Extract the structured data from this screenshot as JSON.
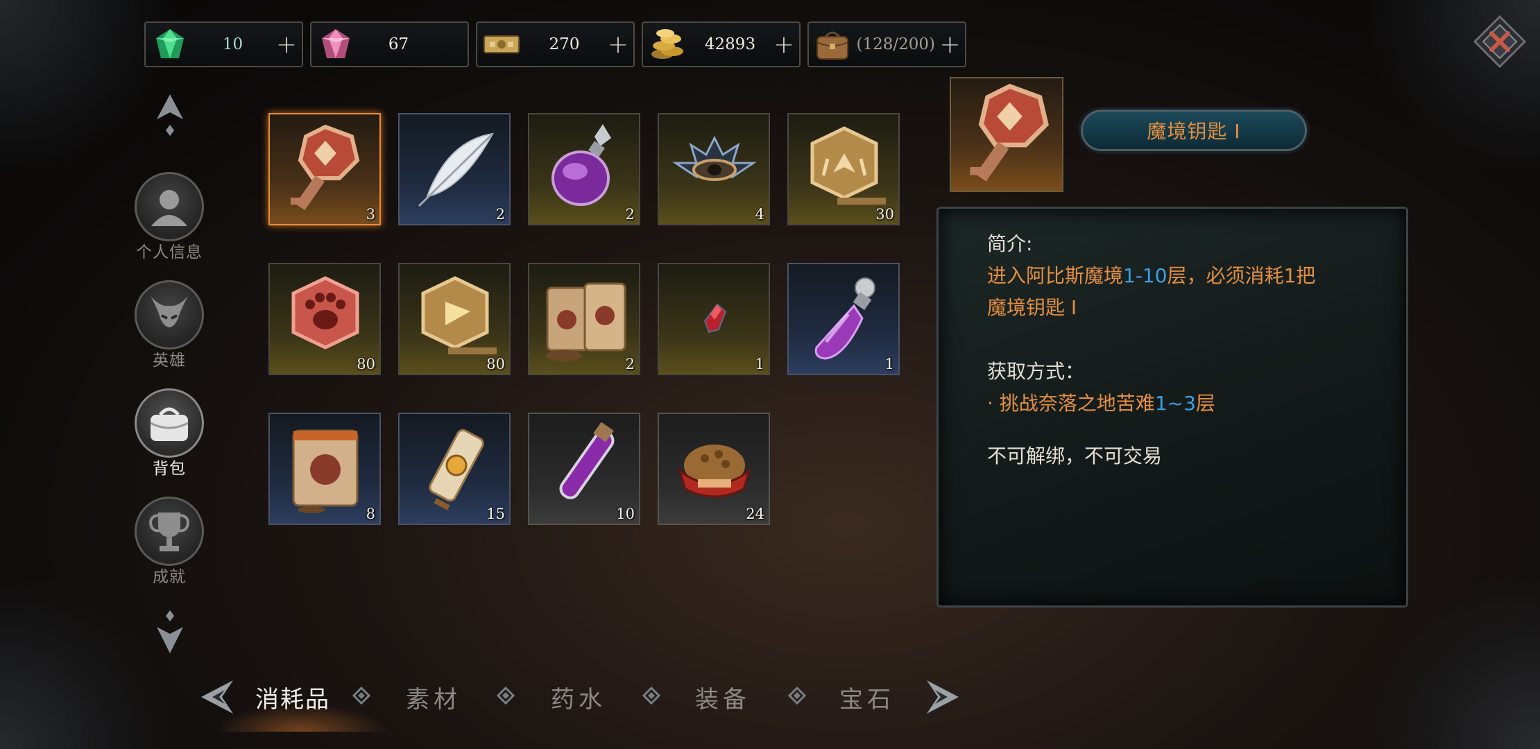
{
  "currencies": [
    {
      "name": "green-gem",
      "value": "10",
      "color": "#a9d6d4"
    },
    {
      "name": "pink-gem",
      "value": "67",
      "color": "#f1ece2"
    },
    {
      "name": "ticket",
      "value": "270",
      "color": "#f1ece2"
    },
    {
      "name": "gold-coins",
      "value": "42893",
      "color": "#f1ece2"
    },
    {
      "name": "bag-capacity",
      "value": "(128/200)",
      "color": "#a79e92"
    }
  ],
  "nav": [
    {
      "label": "个人信息",
      "icon": "person-icon"
    },
    {
      "label": "英雄",
      "icon": "demon-helmet-icon"
    },
    {
      "label": "背包",
      "icon": "bag-icon",
      "active": true
    },
    {
      "label": "成就",
      "icon": "trophy-icon"
    }
  ],
  "inventory": [
    {
      "name": "magic-key",
      "count": "3",
      "rarity": "orange",
      "selected": true
    },
    {
      "name": "white-feather",
      "count": "2",
      "rarity": "blue"
    },
    {
      "name": "purple-flask",
      "count": "2",
      "rarity": "gold"
    },
    {
      "name": "crown-emblem",
      "count": "4",
      "rarity": "gold"
    },
    {
      "name": "gold-plate-wings",
      "count": "30",
      "rarity": "gold"
    },
    {
      "name": "red-paw-token",
      "count": "80",
      "rarity": "gold"
    },
    {
      "name": "gold-plate-gem",
      "count": "80",
      "rarity": "gold"
    },
    {
      "name": "feed-sacks",
      "count": "2",
      "rarity": "gold"
    },
    {
      "name": "red-crystal",
      "count": "1",
      "rarity": "gold"
    },
    {
      "name": "purple-potion",
      "count": "1",
      "rarity": "blue"
    },
    {
      "name": "feed-bag",
      "count": "8",
      "rarity": "blue"
    },
    {
      "name": "scroll",
      "count": "15",
      "rarity": "blue"
    },
    {
      "name": "purple-vial",
      "count": "10",
      "rarity": "gray"
    },
    {
      "name": "food-bowl",
      "count": "24",
      "rarity": "gray"
    }
  ],
  "detail": {
    "name": "魔境钥匙 I",
    "intro_label": "简介:",
    "desc_1a": "进入阿比斯魔境",
    "desc_1b": "1-10",
    "desc_1c": "层，必须消耗1把",
    "desc_2": "魔境钥匙 I",
    "obtain_label": "获取方式：",
    "obtain_a": "· 挑战奈落之地苦难",
    "obtain_b": "1~3",
    "obtain_c": "层",
    "bind_text": "不可解绑，不可交易"
  },
  "tabs": [
    {
      "label": "消耗品",
      "active": true
    },
    {
      "label": "素材"
    },
    {
      "label": "药水"
    },
    {
      "label": "装备"
    },
    {
      "label": "宝石"
    }
  ],
  "colors": {
    "accent_orange": "#e68f3e",
    "accent_blue": "#3aa1e6",
    "selected_border": "#e48d3b"
  }
}
